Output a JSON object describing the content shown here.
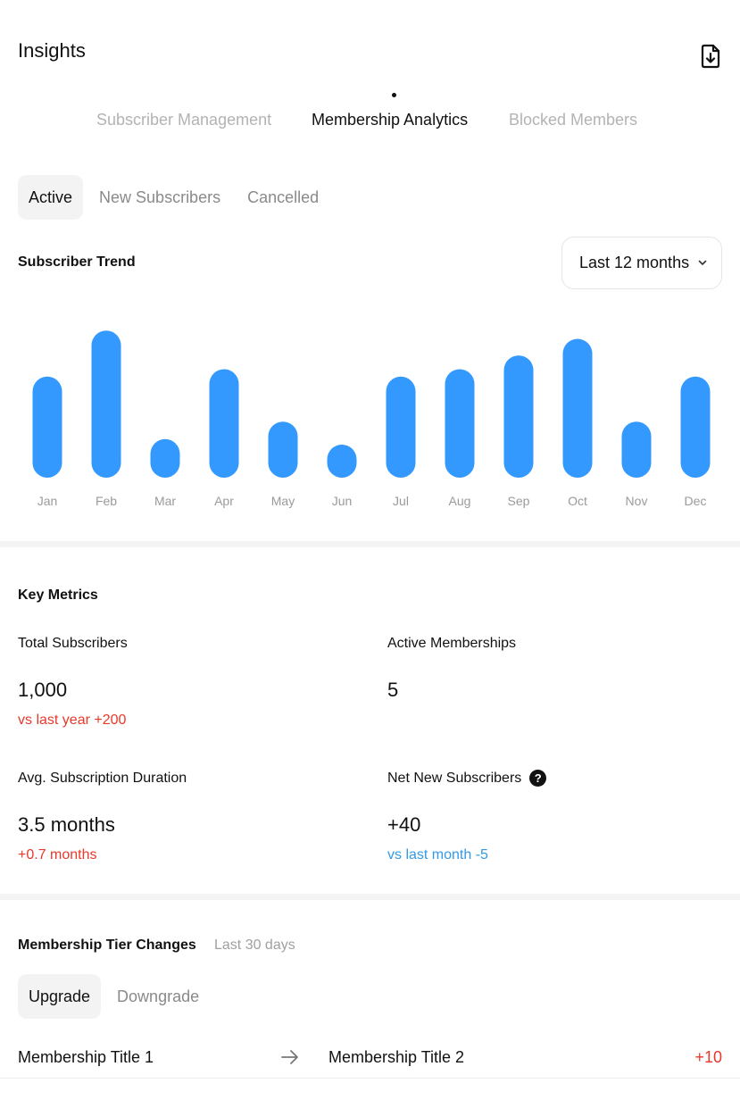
{
  "header": {
    "title": "Insights",
    "export_icon": "file-download-icon"
  },
  "top_tabs": [
    {
      "label": "Subscriber Management",
      "active": false
    },
    {
      "label": "Membership Analytics",
      "active": true
    },
    {
      "label": "Blocked Members",
      "active": false
    }
  ],
  "status_tabs": [
    {
      "label": "Active",
      "active": true
    },
    {
      "label": "New Subscribers",
      "active": false
    },
    {
      "label": "Cancelled",
      "active": false
    }
  ],
  "trend": {
    "title": "Subscriber Trend",
    "range_label": "Last 12 months",
    "range_icon": "chevron-down-icon"
  },
  "chart_data": {
    "type": "bar",
    "categories": [
      "Jan",
      "Feb",
      "Mar",
      "Apr",
      "May",
      "Jun",
      "Jul",
      "Aug",
      "Sep",
      "Oct",
      "Nov",
      "Dec"
    ],
    "values": [
      110,
      160,
      42,
      118,
      61,
      36,
      110,
      118,
      133,
      151,
      61,
      110
    ],
    "ylim": [
      0,
      170
    ],
    "grid": false,
    "color": "#3399ff"
  },
  "key_metrics": {
    "title": "Key Metrics",
    "total_subscribers": {
      "label": "Total Subscribers",
      "value": "1,000",
      "delta": "vs last year +200"
    },
    "active_memberships": {
      "label": "Active Memberships",
      "value": "5"
    },
    "avg_duration": {
      "label": "Avg. Subscription Duration",
      "value": "3.5 months",
      "delta": "+0.7 months"
    },
    "net_new": {
      "label": "Net New Subscribers",
      "value": "+40",
      "delta": "vs last month -5",
      "help_icon": "question-circle-icon"
    }
  },
  "tier_changes": {
    "title": "Membership Tier Changes",
    "subtitle": "Last 30 days",
    "tabs": [
      {
        "label": "Upgrade",
        "active": true
      },
      {
        "label": "Downgrade",
        "active": false
      }
    ],
    "rows": [
      {
        "from": "Membership Title 1",
        "to": "Membership Title 2",
        "delta": "+10"
      }
    ]
  },
  "colors": {
    "accent": "#3399ff",
    "positive": "#e8392b",
    "negative": "#3399e6",
    "muted": "#b3b3b3"
  }
}
